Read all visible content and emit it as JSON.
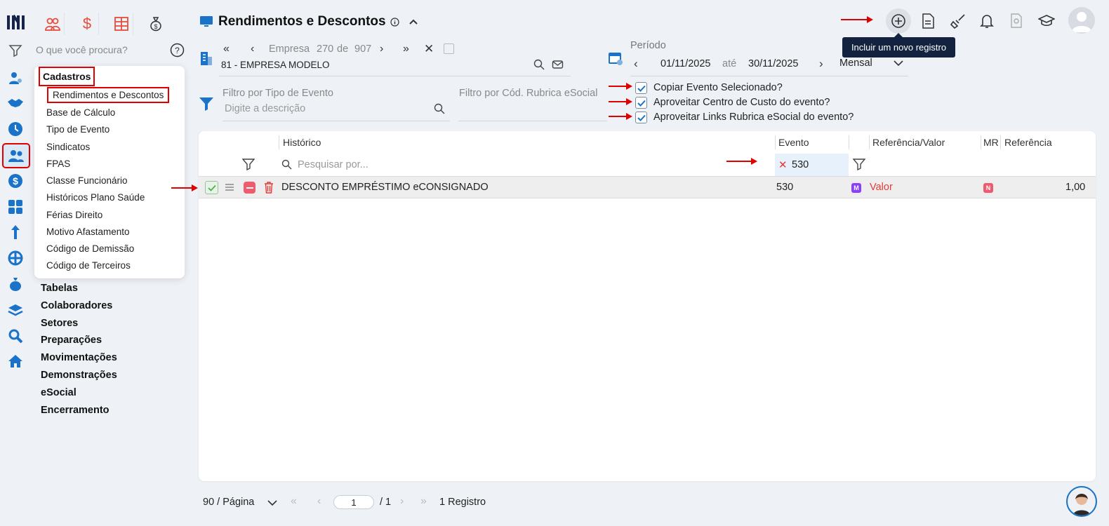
{
  "app": {
    "title": "Rendimentos e Descontos",
    "search_placeholder": "O que você procura?"
  },
  "menu": {
    "heading": "Cadastros",
    "items": [
      "Rendimentos e Descontos",
      "Base de Cálculo",
      "Tipo de Evento",
      "Sindicatos",
      "FPAS",
      "Classe Funcionário",
      "Históricos Plano Saúde",
      "Férias Direito",
      "Motivo Afastamento",
      "Código de Demissão",
      "Código de Terceiros"
    ]
  },
  "nav": [
    "Tabelas",
    "Colaboradores",
    "Setores",
    "Preparações",
    "Movimentações",
    "Demonstrações",
    "eSocial",
    "Encerramento"
  ],
  "empresa": {
    "nav_label": "Empresa",
    "current": "270",
    "de": "de",
    "total": "907",
    "value": "81 - EMPRESA MODELO"
  },
  "periodo": {
    "label": "Período",
    "start": "01/11/2025",
    "ate": "até",
    "end": "30/11/2025",
    "mode": "Mensal"
  },
  "filters": {
    "tipo_label": "Filtro por Tipo de Evento",
    "tipo_placeholder": "Digite a descrição",
    "rubrica_label": "Filtro por Cód. Rubrica eSocial"
  },
  "options": [
    {
      "label": "Copiar Evento Selecionado?",
      "checked": true
    },
    {
      "label": "Aproveitar Centro de Custo do evento?",
      "checked": true
    },
    {
      "label": "Aproveitar Links Rubrica eSocial do evento?",
      "checked": true
    }
  ],
  "tooltip": "Incluir um novo registro",
  "table": {
    "columns": {
      "historico": "Histórico",
      "evento": "Evento",
      "ref_valor": "Referência/Valor",
      "mr": "MR",
      "referencia": "Referência"
    },
    "search_placeholder": "Pesquisar por...",
    "evento_filter": "530",
    "rows": [
      {
        "historico": "DESCONTO EMPRÉSTIMO eCONSIGNADO",
        "evento": "530",
        "tipo_badge": "M",
        "ref_valor": "Valor",
        "mr_badge": "N",
        "referencia": "1,00"
      }
    ]
  },
  "pager": {
    "per_page": "90 / Página",
    "page": "1",
    "total_pages": "/ 1",
    "records": "1 Registro"
  },
  "colors": {
    "accent_blue": "#1a73c9",
    "red": "#e53935",
    "purple_badge": "#8a3ffc",
    "pink_badge": "#f05a6e",
    "tooltip_bg": "#12223f"
  }
}
